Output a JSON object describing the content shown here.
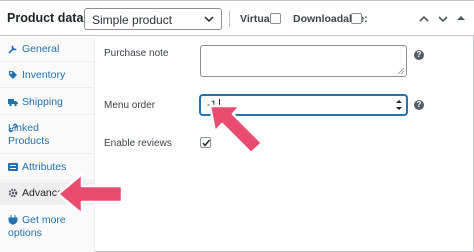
{
  "header": {
    "title": "Product data —",
    "product_type": "Simple product",
    "virtual_label": "Virtual:",
    "downloadable_label": "Downloadable:"
  },
  "sidebar": {
    "items": [
      {
        "label": "General",
        "icon": "wrench-icon"
      },
      {
        "label": "Inventory",
        "icon": "tag-icon"
      },
      {
        "label": "Shipping",
        "icon": "truck-icon"
      },
      {
        "label": "Linked Products",
        "icon": "link-icon"
      },
      {
        "label": "Attributes",
        "icon": "list-icon"
      },
      {
        "label": "Advanced",
        "icon": "gear-icon",
        "active": true
      },
      {
        "label": "Get more options",
        "icon": "plugin-icon"
      }
    ]
  },
  "fields": {
    "purchase_note_label": "Purchase note",
    "purchase_note_value": "",
    "menu_order_label": "Menu order",
    "menu_order_value": "-1",
    "enable_reviews_label": "Enable reviews",
    "enable_reviews_checked": true
  },
  "colors": {
    "link": "#2271b1",
    "focus": "#2271b1",
    "annotation_arrow": "#ea4c6f"
  }
}
